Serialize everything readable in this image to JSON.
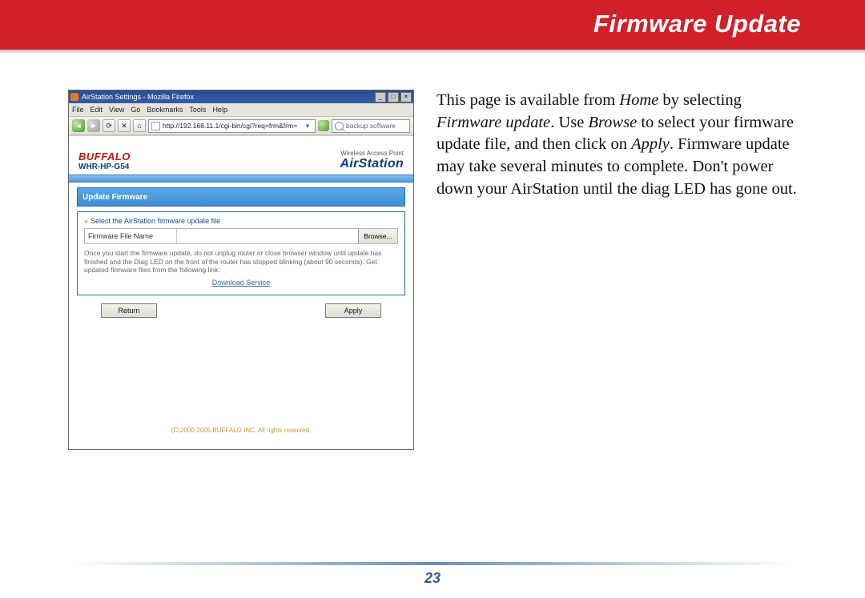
{
  "header": {
    "title": "Firmware Update"
  },
  "body": {
    "p1a": "This page is available from ",
    "home": "Home",
    "p1b": " by selecting ",
    "fwu": "Firmware update",
    "p1c": ".  Use ",
    "browse": "Browse",
    "p1d": " to select your firmware update file, and then click on ",
    "apply": "Apply",
    "p1e": ".  Firmware update may take several minutes to complete.  Don't power down your AirStation until the diag LED has gone out."
  },
  "screenshot": {
    "window_title": "AirStation Settings - Mozilla Firefox",
    "menus": [
      "File",
      "Edit",
      "View",
      "Go",
      "Bookmarks",
      "Tools",
      "Help"
    ],
    "url": "http://192.168.11.1/cgi-bin/cgi?req=frm&frm=",
    "search_placeholder": "backup software",
    "brand": {
      "logo": "BUFFALO",
      "model": "WHR-HP-G54",
      "tag": "Wireless Access Point",
      "air": "AirStation"
    },
    "section_title": "Update Firmware",
    "hint": "Select the AirStation firmware update file",
    "file_label": "Firmware File Name",
    "browse_btn": "Browse...",
    "note": "Once you start the firmware update, do not unplug router or close browser window until update has finished and the Diag LED on the front of the router has stopped blinking (about 90 seconds). Get updated firmware files from the following link:",
    "download_link": "Download Service",
    "return_btn": "Return",
    "apply_btn": "Apply",
    "copyright": "(C)2000-2005 BUFFALO INC. All rights reserved."
  },
  "pagenum": "23"
}
